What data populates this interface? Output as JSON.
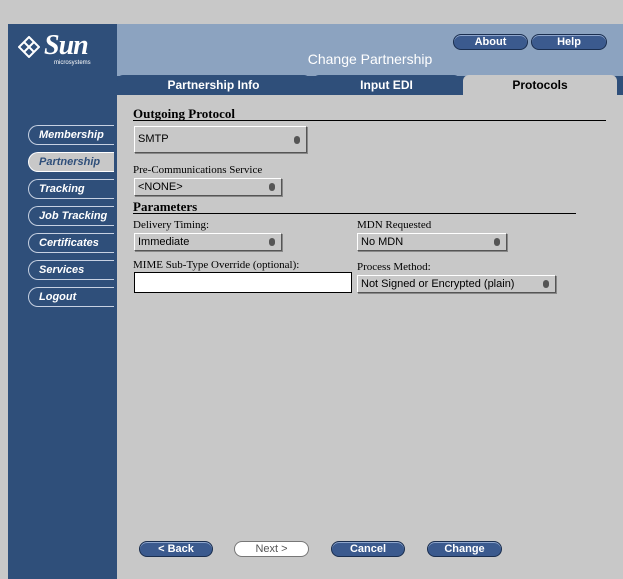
{
  "logo": {
    "word": "Sun",
    "sub": "microsystems"
  },
  "header": {
    "title": "Change Partnership",
    "about_label": "About",
    "help_label": "Help"
  },
  "nav": {
    "items": [
      {
        "label": "Membership",
        "active": false
      },
      {
        "label": "Partnership",
        "active": true
      },
      {
        "label": "Tracking",
        "active": false
      },
      {
        "label": "Job Tracking",
        "active": false
      },
      {
        "label": "Certificates",
        "active": false
      },
      {
        "label": "Services",
        "active": false
      },
      {
        "label": "Logout",
        "active": false
      }
    ]
  },
  "tabs": [
    {
      "label": "Partnership Info",
      "active": false
    },
    {
      "label": "Input EDI",
      "active": false
    },
    {
      "label": "Protocols",
      "active": true
    }
  ],
  "form": {
    "outgoing_protocol": {
      "title": "Outgoing Protocol",
      "value": "SMTP"
    },
    "pre_comm": {
      "label": "Pre-Communications Service",
      "value": "<NONE>"
    },
    "parameters_title": "Parameters",
    "delivery_timing": {
      "label": "Delivery Timing:",
      "value": "Immediate"
    },
    "mdn_requested": {
      "label": "MDN Requested",
      "value": "No MDN"
    },
    "mime_override": {
      "label": "MIME Sub-Type Override (optional):",
      "value": ""
    },
    "process_method": {
      "label": "Process Method:",
      "value": "Not Signed or Encrypted (plain)"
    }
  },
  "wizard": {
    "back_label": "< Back",
    "next_label": "Next >",
    "cancel_label": "Cancel",
    "change_label": "Change"
  },
  "colors": {
    "navy": "#2f4f7a",
    "header": "#8ca3c0",
    "panel": "#c8c8c8",
    "button": "#3b5a8e"
  }
}
